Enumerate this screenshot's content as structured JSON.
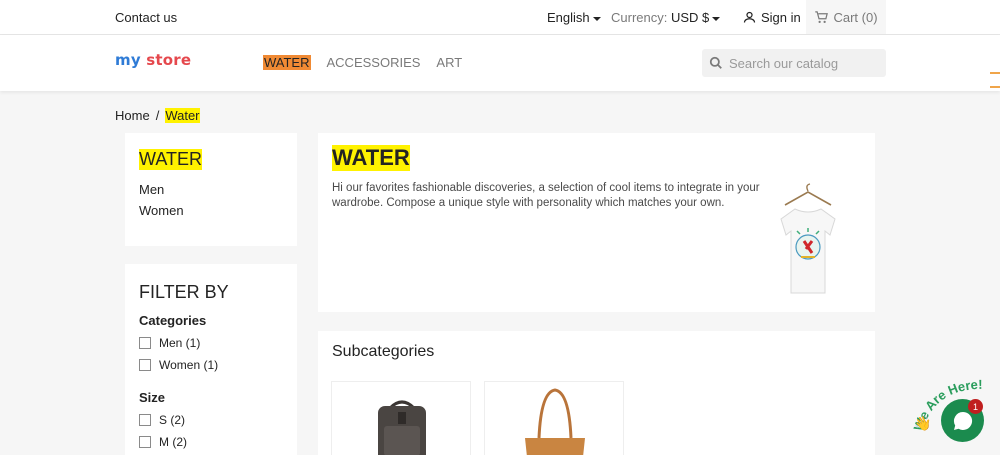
{
  "topbar": {
    "contact": "Contact us",
    "language": "English",
    "currency_label": "Currency:",
    "currency_value": "USD $",
    "signin": "Sign in",
    "cart": "Cart (0)"
  },
  "header": {
    "logo_part1": "my ",
    "logo_part2": "store",
    "nav": [
      "WATER",
      "ACCESSORIES",
      "ART"
    ],
    "search_placeholder": "Search our catalog"
  },
  "breadcrumb": {
    "home": "Home",
    "separator": "/",
    "current": "Water"
  },
  "sidebar": {
    "category_title": "WATER",
    "subcategories": [
      "Men",
      "Women"
    ],
    "filter_title": "FILTER BY",
    "categories_heading": "Categories",
    "category_facets": [
      "Men (1)",
      "Women (1)"
    ],
    "size_heading": "Size",
    "size_facets": [
      "S (2)",
      "M (2)"
    ]
  },
  "main": {
    "title": "WATER",
    "description": "Hi our favorites fashionable discoveries, a selection of cool items to integrate in your wardrobe. Compose a unique style with personality which matches your own.",
    "subcategories_heading": "Subcategories"
  },
  "widget": {
    "text": "We Are Here!",
    "badge": "1"
  },
  "colors": {
    "highlight": "#fff200",
    "nav_active": "#f08a34",
    "chat": "#1b8b4e"
  }
}
